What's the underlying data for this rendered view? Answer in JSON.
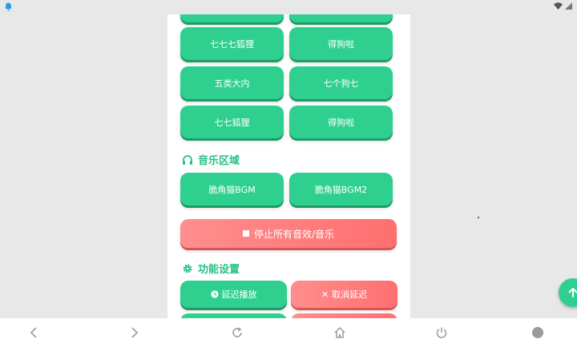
{
  "sound_buttons": {
    "row0_left": "",
    "row0_right": "",
    "row1_left": "七七七狐狸",
    "row1_right": "得狗啦",
    "row2_left": "五类大内",
    "row2_right": "七个狗七",
    "row3_left": "七七狐狸",
    "row3_right": "得狗啦"
  },
  "music_section": {
    "title": "音乐区域",
    "icon": "headphones-icon",
    "bgm1": "脆角猫BGM",
    "bgm2": "脆角猫BGM2",
    "stop_all": "停止所有音效/音乐"
  },
  "settings_section": {
    "title": "功能设置",
    "icon": "gear-icon",
    "delay_play": "延迟播放",
    "cancel_delay": "取消延迟"
  },
  "colors": {
    "accent": "#2fd08f",
    "danger": "#ff7070",
    "title": "#27c184"
  },
  "navbar": {
    "items": [
      "back-icon",
      "forward-icon",
      "refresh-icon",
      "home-icon",
      "power-icon",
      "circle-icon"
    ]
  }
}
